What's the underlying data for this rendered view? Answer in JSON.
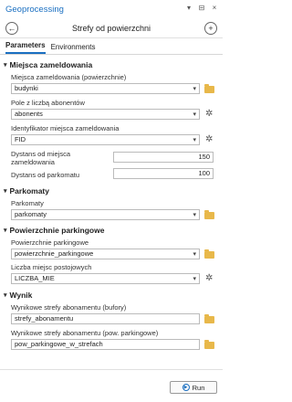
{
  "window": {
    "title": "Geoprocessing",
    "controls": [
      "▾",
      "⊟",
      "×"
    ]
  },
  "tool": {
    "back_icon": "←",
    "name": "Strefy od powierzchni",
    "add_icon": "+"
  },
  "tabs": [
    {
      "label": "Parameters",
      "active": true
    },
    {
      "label": "Environments",
      "active": false
    }
  ],
  "sections": {
    "miejsca": {
      "title": "Miejsca zameldowania",
      "input_label": "Miejsca zameldowania (powierzchnie)",
      "input_value": "budynki",
      "count_field_label": "Pole z liczbą abonentów",
      "count_field_value": "abonents",
      "id_label": "Identyfikator miejsca zameldowania",
      "id_value": "FID",
      "dist_miejsca_label": "Dystans od miejsca zameldowania",
      "dist_miejsca_value": "150",
      "dist_parkomatu_label": "Dystans od parkomatu",
      "dist_parkomatu_value": "100"
    },
    "parkomaty": {
      "title": "Parkomaty",
      "input_label": "Parkomaty",
      "input_value": "parkomaty"
    },
    "powierzchnie": {
      "title": "Powierzchnie parkingowe",
      "input_label": "Powierzchnie parkingowe",
      "input_value": "powierzchnie_parkingowe",
      "count_label": "Liczba miejsc postojowych",
      "count_value": "LICZBA_MIE"
    },
    "wynik": {
      "title": "Wynik",
      "out1_label": "Wynikowe strefy abonamentu (bufory)",
      "out1_value": "strefy_abonamentu",
      "out2_label": "Wynikowe strefy abonamentu (pow. parkingowe)",
      "out2_value": "pow_parkingowe_w_strefach"
    }
  },
  "footer": {
    "run_label": "Run"
  },
  "colors": {
    "accent": "#1a6fc1",
    "required": "#c0392b",
    "folder": "#e8b84a"
  }
}
